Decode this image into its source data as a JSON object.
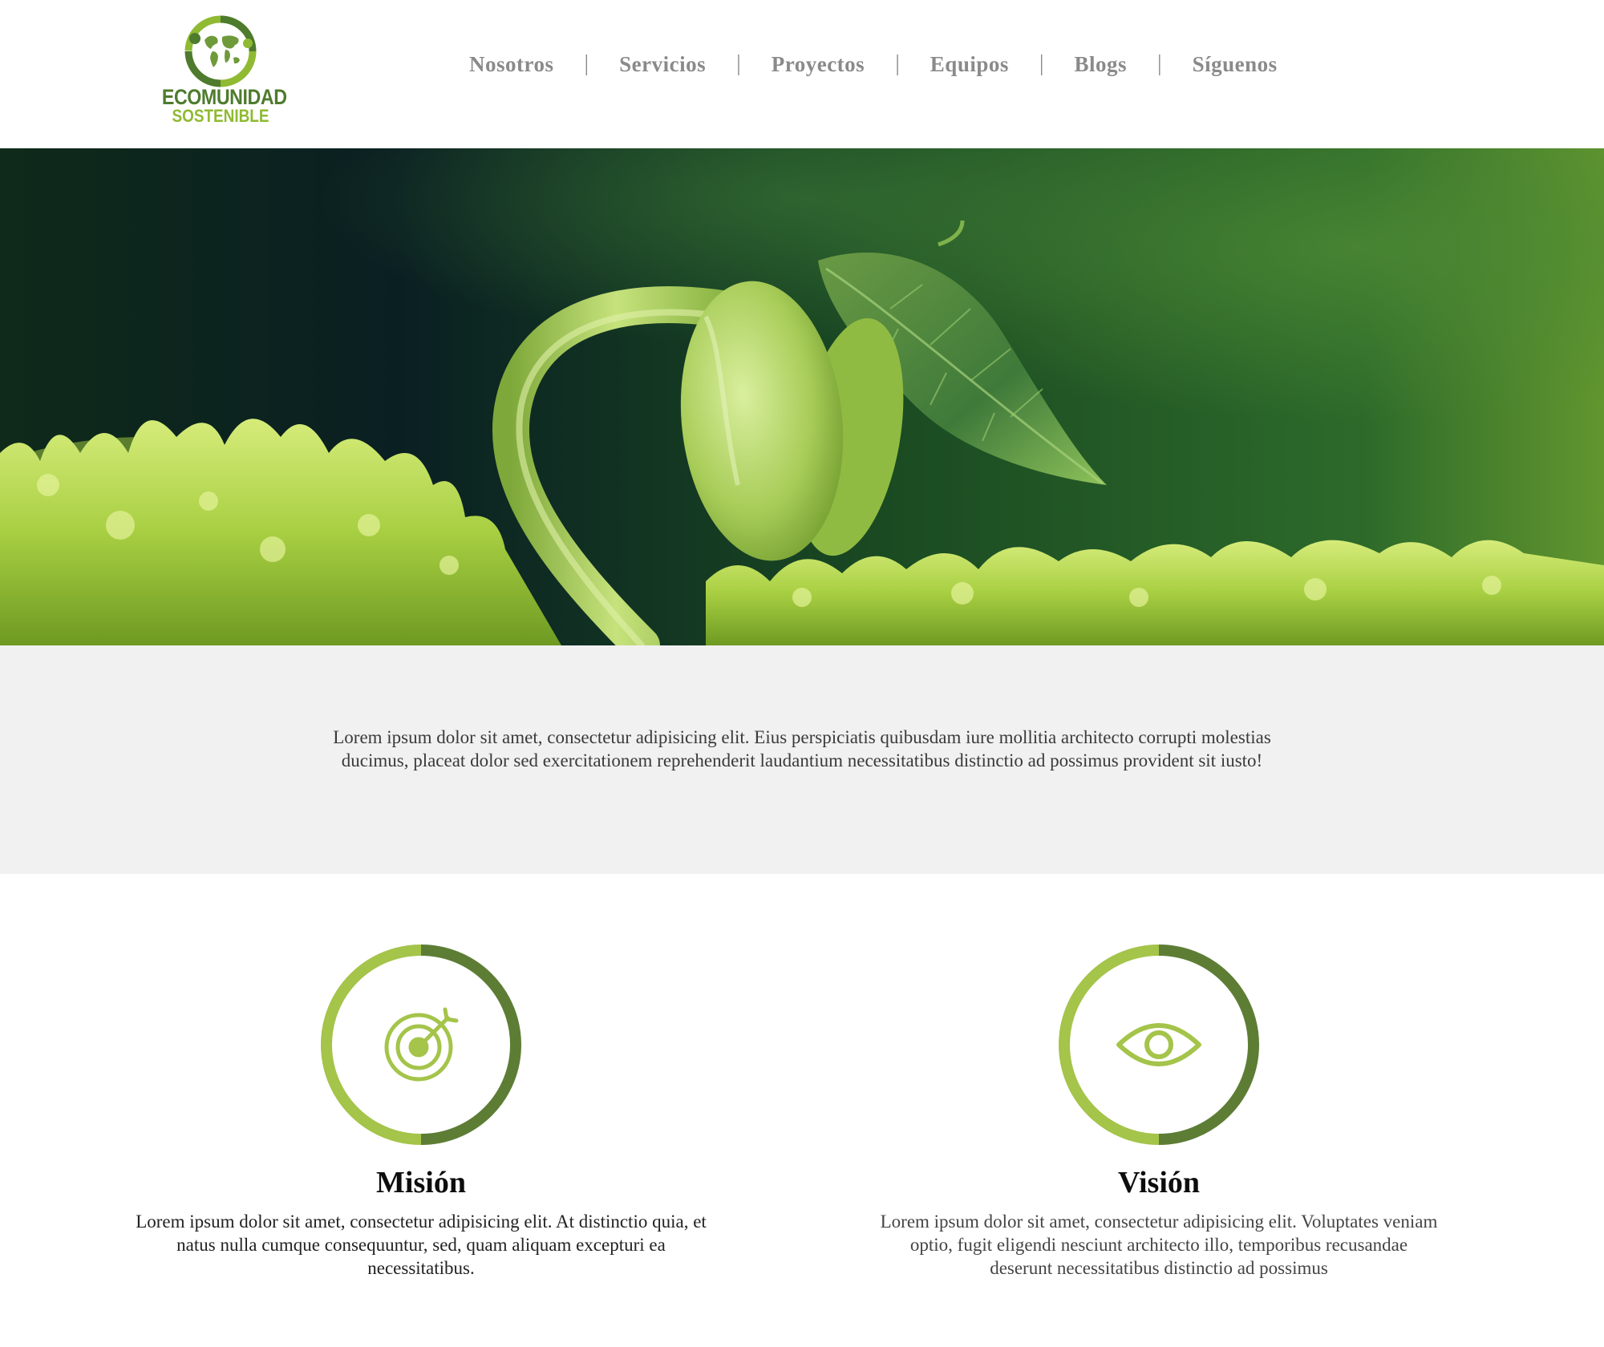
{
  "brand": {
    "line1": "ECOMUNIDAD",
    "line2": "SOSTENIBLE",
    "color_dark": "#4e7b2e",
    "color_light": "#8fba32"
  },
  "nav": {
    "items": [
      {
        "label": "Nosotros"
      },
      {
        "label": "Servicios"
      },
      {
        "label": "Proyectos"
      },
      {
        "label": "Equipos"
      },
      {
        "label": "Blogs"
      },
      {
        "label": "Síguenos"
      }
    ],
    "separator": "|"
  },
  "hero": {
    "image": "sprouting-bean-seedling-on-moss"
  },
  "intro": {
    "text": "Lorem ipsum dolor sit amet, consectetur adipisicing elit. Eius perspiciatis quibusdam iure mollitia architecto corrupti molestias ducimus, placeat dolor sed exercitationem reprehenderit laudantium necessitatibus distinctio ad possimus provident sit iusto!"
  },
  "mission": {
    "icon": "target-icon",
    "title": "Misión",
    "text": "Lorem ipsum dolor sit amet, consectetur adipisicing elit. At distinctio quia, et natus nulla cumque consequuntur, sed, quam aliquam excepturi ea necessitatibus."
  },
  "vision": {
    "icon": "eye-icon",
    "title": "Visión",
    "text": "Lorem ipsum dolor sit amet, consectetur adipisicing elit. Voluptates veniam optio, fugit eligendi nesciunt architecto illo, temporibus recusandae deserunt necessitatibus distinctio ad possimus"
  },
  "colors": {
    "ring_light": "#a4c44a",
    "ring_dark": "#5d7d35",
    "icon": "#a4c44a",
    "intro_bg": "#f2f1f2"
  }
}
